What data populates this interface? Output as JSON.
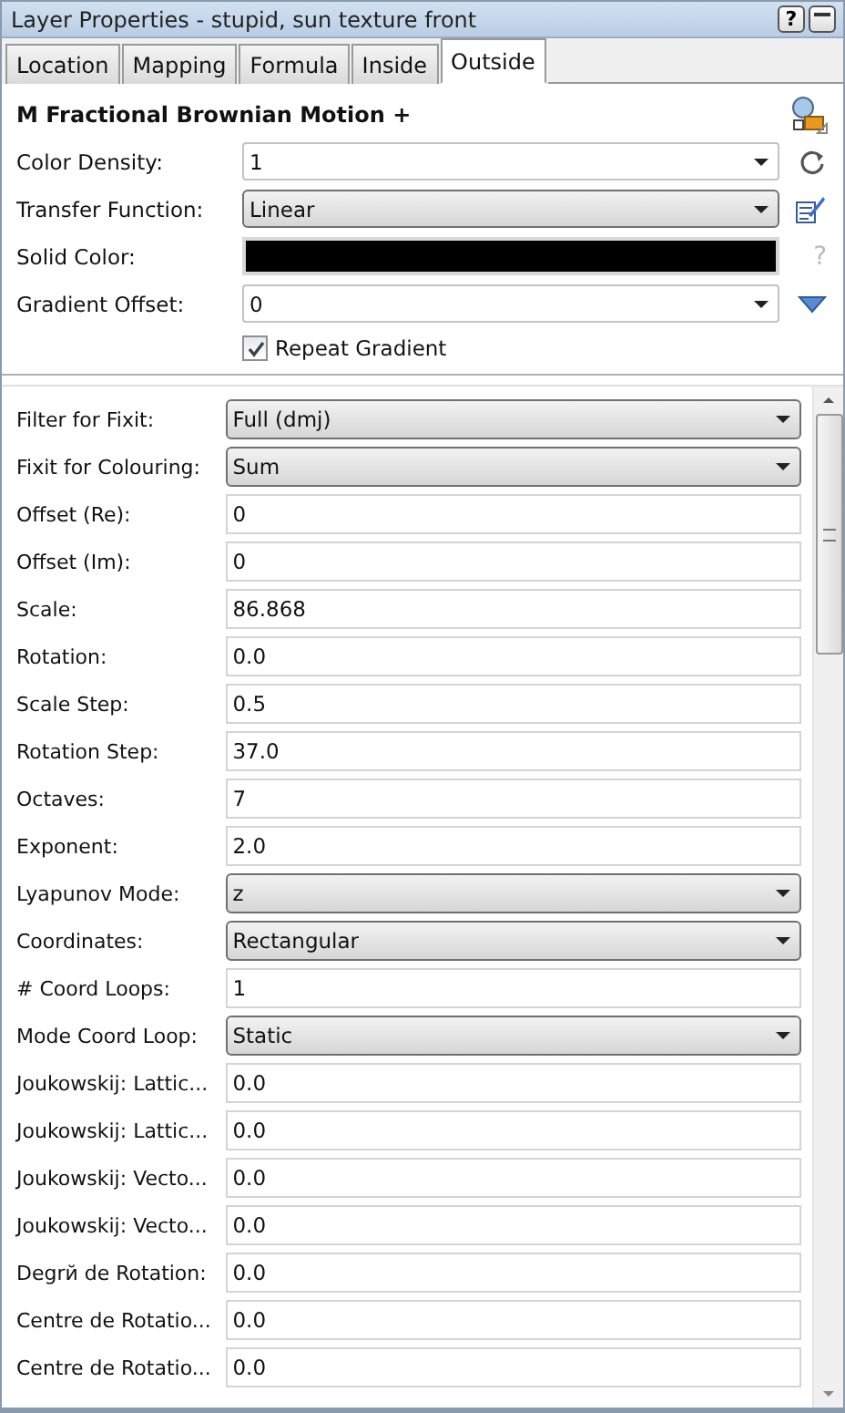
{
  "window": {
    "title": "Layer Properties - stupid, sun texture front",
    "buttons": [
      "?"
    ]
  },
  "tabs": [
    {
      "label": "Location",
      "selected": false
    },
    {
      "label": "Mapping",
      "selected": false
    },
    {
      "label": "Formula",
      "selected": false
    },
    {
      "label": "Inside",
      "selected": false
    },
    {
      "label": "Outside",
      "selected": true
    }
  ],
  "header": {
    "title": "M Fractional Brownian Motion +",
    "fields": [
      {
        "label": "Color Density:",
        "kind": "combo",
        "value": "1",
        "side": {
          "kind": "reset"
        }
      },
      {
        "label": "Transfer Function:",
        "kind": "select",
        "value": "Linear",
        "side": {
          "kind": "edit"
        }
      },
      {
        "label": "Solid Color:",
        "kind": "color",
        "color": "#000000",
        "side": {
          "kind": "help",
          "text": "?"
        }
      },
      {
        "label": "Gradient Offset:",
        "kind": "combo",
        "value": "0",
        "side": {
          "kind": "down"
        }
      }
    ],
    "repeat_gradient": {
      "label": "Repeat Gradient",
      "checked": true
    }
  },
  "parameters": [
    {
      "label": "Filter for Fixit:",
      "kind": "select",
      "value": "Full (dmj)"
    },
    {
      "label": "Fixit for Colouring:",
      "kind": "select",
      "value": "Sum"
    },
    {
      "label": "Offset (Re):",
      "kind": "text",
      "value": "0"
    },
    {
      "label": "Offset (Im):",
      "kind": "text",
      "value": "0"
    },
    {
      "label": "Scale:",
      "kind": "text",
      "value": "86.868"
    },
    {
      "label": "Rotation:",
      "kind": "text",
      "value": "0.0"
    },
    {
      "label": "Scale Step:",
      "kind": "text",
      "value": "0.5"
    },
    {
      "label": "Rotation Step:",
      "kind": "text",
      "value": "37.0"
    },
    {
      "label": "Octaves:",
      "kind": "text",
      "value": "7"
    },
    {
      "label": "Exponent:",
      "kind": "text",
      "value": "2.0"
    },
    {
      "label": "Lyapunov Mode:",
      "kind": "select",
      "value": "z"
    },
    {
      "label": "Coordinates:",
      "kind": "select",
      "value": "Rectangular"
    },
    {
      "label": "# Coord Loops:",
      "kind": "text",
      "value": "1"
    },
    {
      "label": "Mode Coord Loop:",
      "kind": "select",
      "value": "Static"
    },
    {
      "label": "Joukowskij: Lattic...",
      "kind": "text",
      "value": "0.0"
    },
    {
      "label": "Joukowskij: Lattic...",
      "kind": "text",
      "value": "0.0"
    },
    {
      "label": "Joukowskij: Vecto...",
      "kind": "text",
      "value": "0.0"
    },
    {
      "label": "Joukowskij: Vecto...",
      "kind": "text",
      "value": "0.0"
    },
    {
      "label": "Degrй de Rotation:",
      "kind": "text",
      "value": "0.0"
    },
    {
      "label": "Centre de Rotatio...",
      "kind": "text",
      "value": "0.0"
    },
    {
      "label": "Centre de Rotatio...",
      "kind": "text",
      "value": "0.0"
    }
  ]
}
